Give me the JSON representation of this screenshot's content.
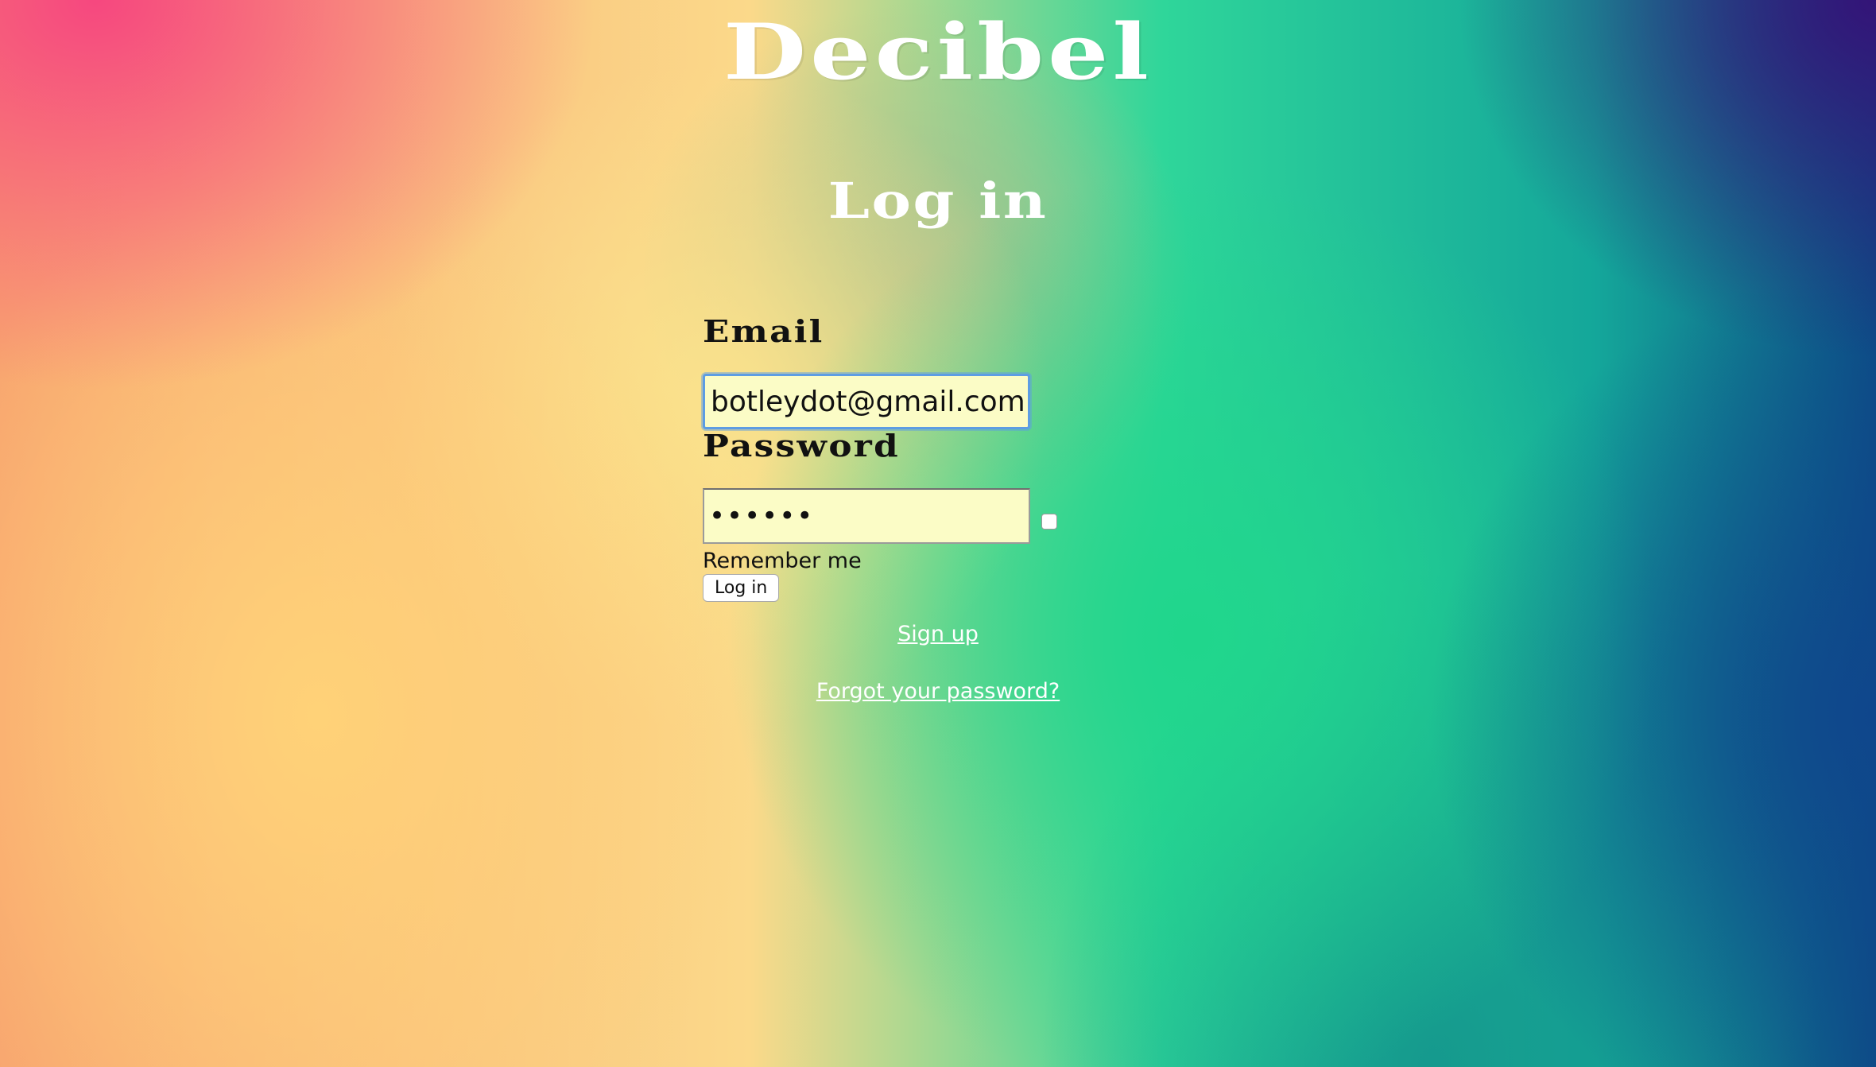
{
  "app": {
    "brand": "Decibel"
  },
  "page": {
    "title": "Log in"
  },
  "form": {
    "email_label": "Email",
    "email_value": "botleydot@gmail.com",
    "password_label": "Password",
    "password_value": "••••••",
    "remember_label": "Remember me",
    "remember_checked": false,
    "submit_label": "Log in"
  },
  "links": {
    "sign_up": "Sign up",
    "forgot_password": "Forgot your password?"
  },
  "colors": {
    "field_background": "#fbfcc6",
    "focus_ring": "#5d9de3",
    "link": "#ffffff"
  }
}
